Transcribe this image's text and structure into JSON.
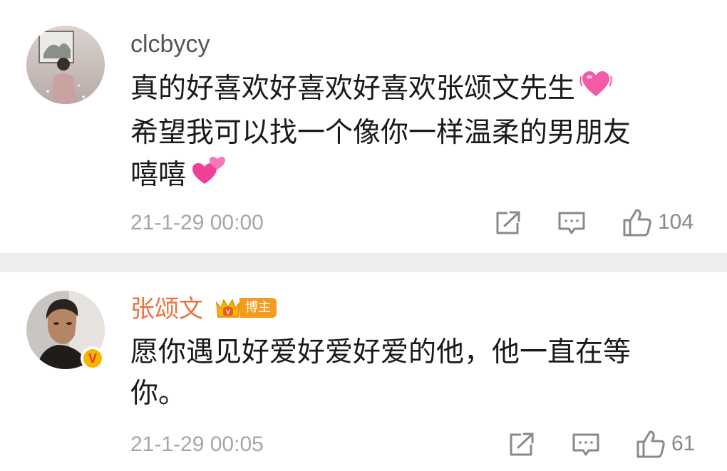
{
  "comments": [
    {
      "username": "clcbycy",
      "lines": [
        "真的好喜欢好喜欢好喜欢张颂文先生",
        "希望我可以找一个像你一样温柔的男朋友",
        "嘻嘻"
      ],
      "timestamp": "21-1-29 00:00",
      "likes": "104",
      "icons": [
        "heart-emoji",
        "two-hearts-emoji"
      ]
    },
    {
      "username": "张颂文",
      "badge": "博主",
      "verified": "V",
      "lines": [
        "愿你遇见好爱好爱好爱的他，他一直在等",
        "你。"
      ],
      "timestamp": "21-1-29 00:05",
      "likes": "61"
    }
  ],
  "colors": {
    "username": "#555555",
    "author_name": "#eb7340",
    "timestamp": "#a6a6a6",
    "separator": "#ededed",
    "badge": "#f39c1e"
  }
}
